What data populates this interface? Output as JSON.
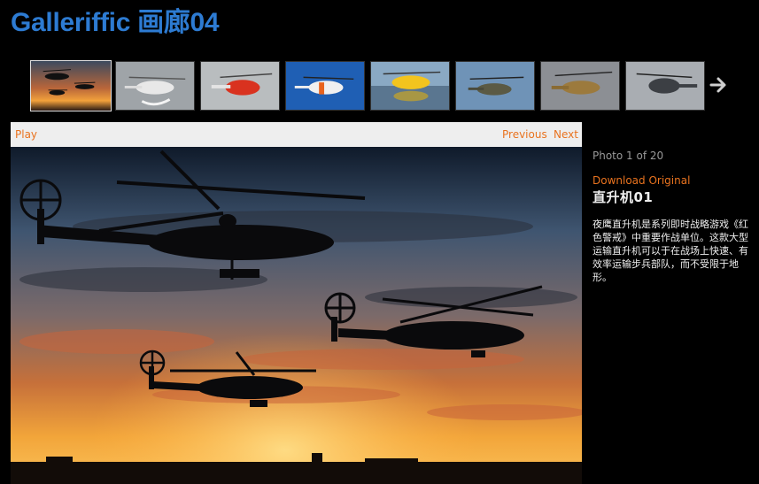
{
  "header": {
    "title": "Galleriffic 画廊04"
  },
  "thumbnails": [
    {
      "name": "thumb-1",
      "selected": true
    },
    {
      "name": "thumb-2"
    },
    {
      "name": "thumb-3"
    },
    {
      "name": "thumb-4"
    },
    {
      "name": "thumb-5"
    },
    {
      "name": "thumb-6"
    },
    {
      "name": "thumb-7"
    },
    {
      "name": "thumb-8"
    }
  ],
  "controls": {
    "play": "Play",
    "previous": "Previous",
    "next": "Next"
  },
  "caption": {
    "count": "Photo 1 of 20",
    "download": "Download Original",
    "title": "直升机01",
    "description": "夜鹰直升机是系列即时战略游戏《红色警戒》中重要作战单位。这款大型运输直升机可以于在战场上快速、有效率运输步兵部队，而不受限于地形。"
  },
  "colors": {
    "accent": "#e9731f",
    "title": "#2d7bd2",
    "background": "#000000"
  }
}
